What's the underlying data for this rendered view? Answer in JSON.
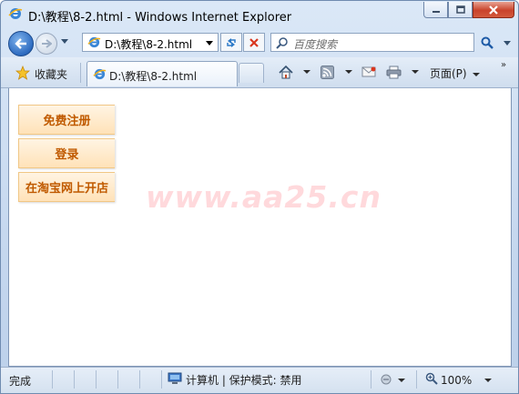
{
  "window": {
    "title": "D:\\教程\\8-2.html - Windows Internet Explorer"
  },
  "address_bar": {
    "url": "D:\\教程\\8-2.html"
  },
  "search": {
    "placeholder": "百度搜索"
  },
  "favorites": {
    "label": "收藏夹"
  },
  "tab": {
    "title": "D:\\教程\\8-2.html"
  },
  "command_bar": {
    "page_menu": "页面(P)"
  },
  "page": {
    "menu": [
      {
        "label": "免费注册"
      },
      {
        "label": "登录"
      },
      {
        "label": "在淘宝网上开店"
      }
    ],
    "watermark": "www.aa25.cn",
    "button_text_color": "#c05a00",
    "button_bg_color": "#ffe9c7"
  },
  "status_bar": {
    "status": "完成",
    "zone": "计算机 | 保护模式: 禁用",
    "zoom": "100%"
  }
}
